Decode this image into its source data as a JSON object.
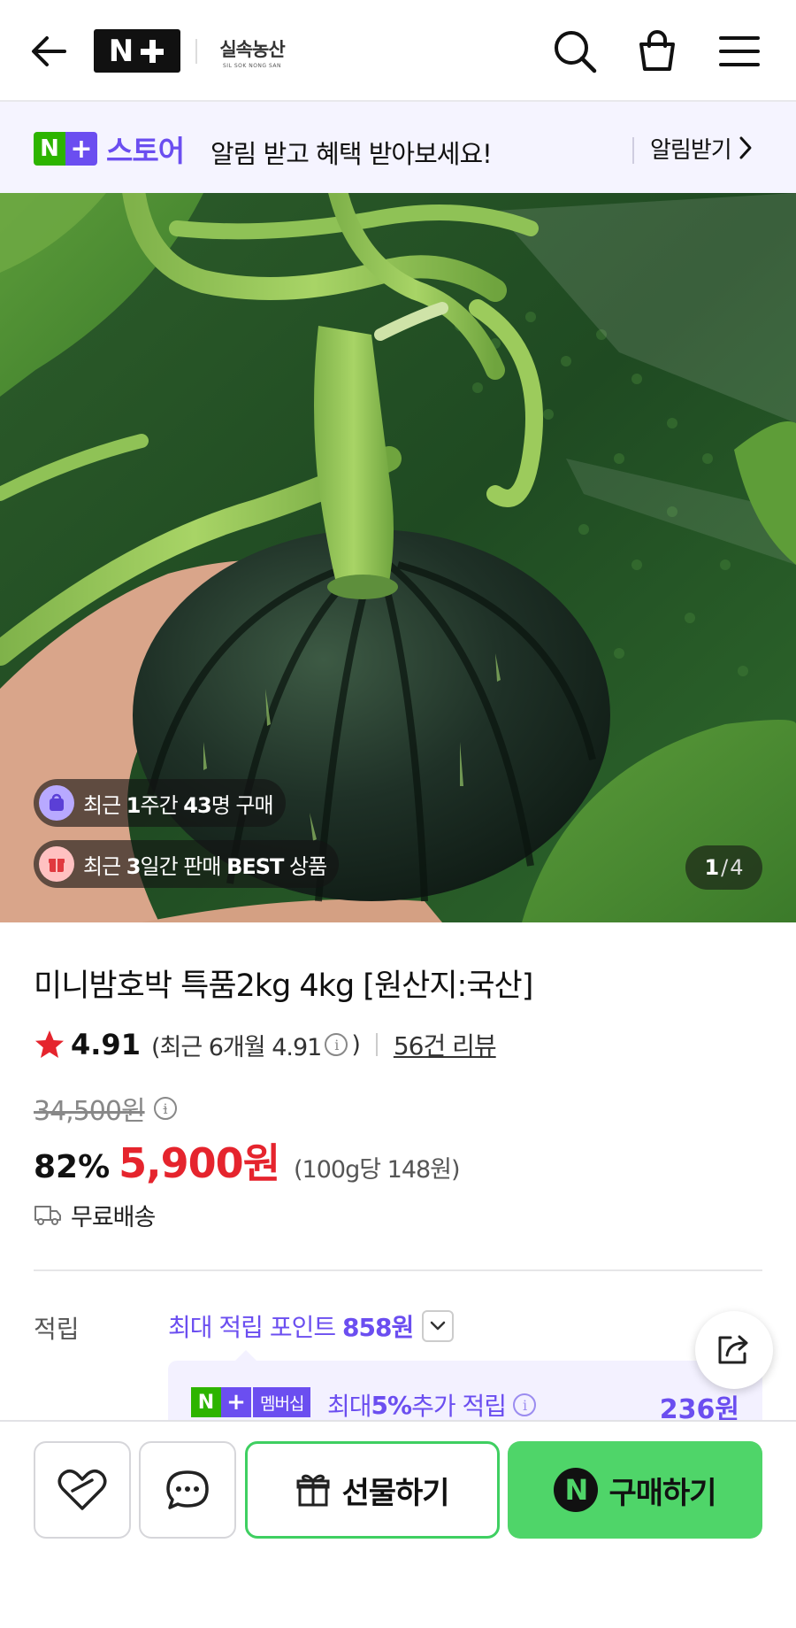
{
  "header": {
    "back_icon": "arrow-left-icon",
    "platform_logo": "N+",
    "shop_name": "실속농산",
    "shop_name_sub": "SIL SOK NONG SAN",
    "icons": [
      "search-icon",
      "shopping-bag-icon",
      "menu-icon"
    ]
  },
  "banner": {
    "store_brand_n": "N",
    "store_brand_plus": "+",
    "store_word": "스토어",
    "message": "알림 받고 혜택 받아보세요!",
    "cta_label": "알림받기"
  },
  "image_badges": {
    "recent_purchases": {
      "prefix": "최근 ",
      "bold1": "1",
      "mid": "주간 ",
      "bold2": "43",
      "suffix": "명 구매"
    },
    "best_seller": {
      "prefix": "최근 ",
      "bold1": "3",
      "mid": "일간 판매 ",
      "bold2": "BEST",
      "suffix": " 상품"
    },
    "pager": {
      "current": "1",
      "separator": "/",
      "total": "4"
    }
  },
  "product": {
    "title": "미니밤호박 특품2kg 4kg [원산지:국산]",
    "rating": "4.91",
    "recent_rating_prefix": "(최근 6개월 4.91",
    "recent_rating_suffix": ")",
    "review_link": "56건 리뷰",
    "original_price": "34,500원",
    "discount_rate": "82%",
    "sale_price_number": "5,900",
    "sale_price_unit": "원",
    "unit_price": "(100g당 148원)",
    "shipping": "무료배송"
  },
  "points": {
    "label": "적립",
    "text_prefix": "최대 적립 포인트 ",
    "text_amount": "858원",
    "membership_tag": "멤버십",
    "membership_text_prefix": "최대 ",
    "membership_text_bold": "5%",
    "membership_text_suffix": " 추가 적립",
    "membership_amount": "236원"
  },
  "bottom_bar": {
    "wishlist_icon": "heart-icon",
    "chat_icon": "chat-bubble-icon",
    "gift_label": "선물하기",
    "buy_mark": "N",
    "buy_label": "구매하기"
  },
  "colors": {
    "accent_purple": "#6b4ef0",
    "price_red": "#e5242d",
    "buy_green": "#4fd569",
    "naver_green": "#2db400"
  }
}
